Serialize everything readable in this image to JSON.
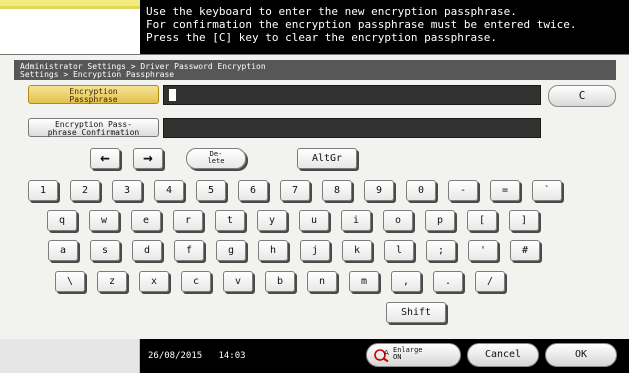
{
  "header": {
    "message_lines": [
      "Use the keyboard to enter the new encryption passphrase.",
      "For confirmation the encryption passphrase must be entered twice.",
      "Press the [C] key to clear the encryption passphrase."
    ]
  },
  "breadcrumb": {
    "line1": "Administrator Settings > Driver Password Encryption",
    "line2": "Settings > Encryption Passphrase"
  },
  "fields": {
    "passphrase_label_l1": "Encryption",
    "passphrase_label_l2": "Passphrase",
    "confirmation_label_l1": "Encryption Pass-",
    "confirmation_label_l2": "phrase Confirmation",
    "clear_label": "C"
  },
  "keyboard": {
    "left_arrow": "←",
    "right_arrow": "→",
    "delete_l1": "De-",
    "delete_l2": "lete",
    "altgr": "AltGr",
    "row1": [
      "1",
      "2",
      "3",
      "4",
      "5",
      "6",
      "7",
      "8",
      "9",
      "0",
      "-",
      "=",
      "`"
    ],
    "row2": [
      "q",
      "w",
      "e",
      "r",
      "t",
      "y",
      "u",
      "i",
      "o",
      "p",
      "[",
      "]"
    ],
    "row3": [
      "a",
      "s",
      "d",
      "f",
      "g",
      "h",
      "j",
      "k",
      "l",
      ";",
      "'",
      "#"
    ],
    "row4": [
      "\\",
      "z",
      "x",
      "c",
      "v",
      "b",
      "n",
      "m",
      ",",
      ".",
      "/"
    ],
    "shift": "Shift"
  },
  "status": {
    "date": "26/08/2015",
    "time": "14:03"
  },
  "buttons": {
    "enlarge_l1": "Enlarge",
    "enlarge_l2": "ON",
    "cancel": "Cancel",
    "ok": "OK"
  }
}
